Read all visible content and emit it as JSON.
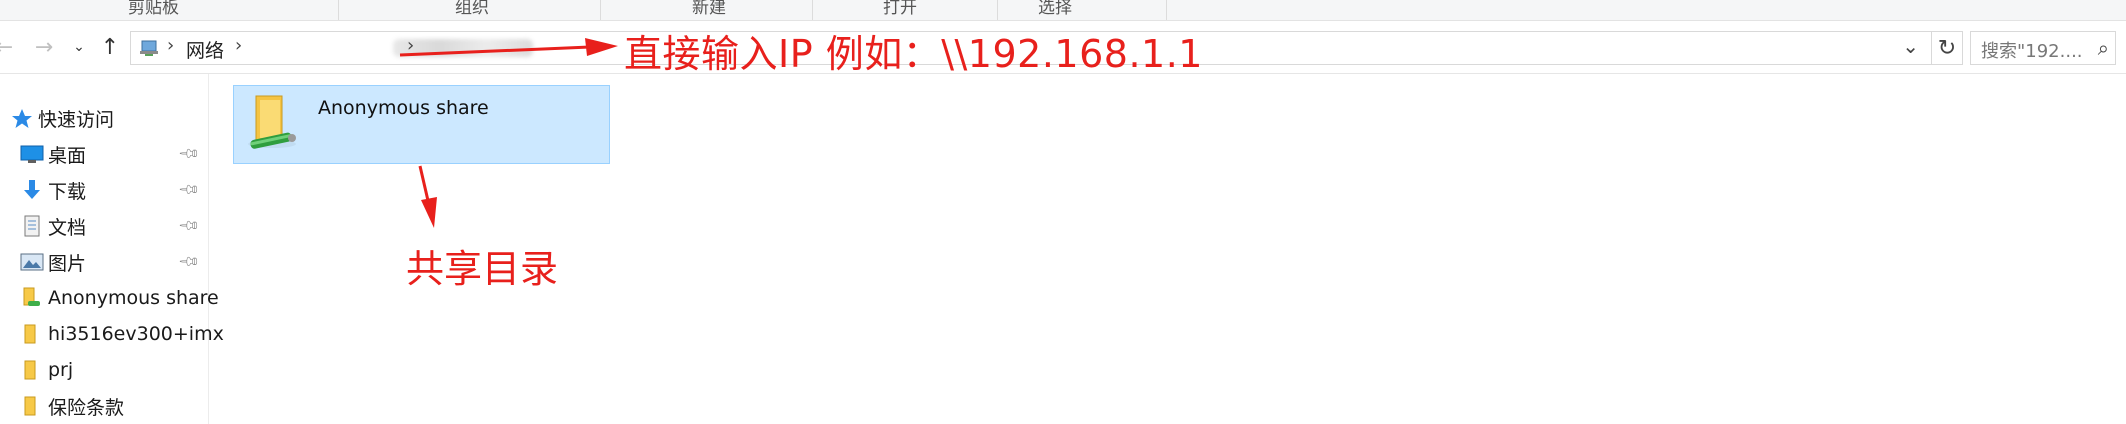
{
  "ribbon": {
    "groups": [
      "剪贴板",
      "组织",
      "新建",
      "打开",
      "选择"
    ]
  },
  "nav": {
    "back_icon": "arrow-left",
    "forward_icon": "arrow-right",
    "recent_icon": "chevron-down",
    "up_icon": "arrow-up",
    "address": {
      "crumb": "网络",
      "blurred_segment": "(redacted)",
      "dropdown_icon": "chevron-down"
    },
    "refresh_icon": "refresh",
    "search_placeholder": "搜索\"192....",
    "search_icon": "magnifier"
  },
  "annotations": {
    "address_hint": "直接输入IP 例如：\\\\192.168.1.1",
    "share_hint": "共享目录",
    "color": "#e8201c"
  },
  "sidebar": {
    "items": [
      {
        "label": "快速访问",
        "icon": "star-icon",
        "pinned": false
      },
      {
        "label": "桌面",
        "icon": "desktop-icon",
        "pinned": true
      },
      {
        "label": "下载",
        "icon": "download-icon",
        "pinned": true
      },
      {
        "label": "文档",
        "icon": "document-icon",
        "pinned": true
      },
      {
        "label": "图片",
        "icon": "pictures-icon",
        "pinned": true
      },
      {
        "label": "Anonymous share",
        "icon": "shared-folder-icon",
        "pinned": false
      },
      {
        "label": "hi3516ev300+imx",
        "icon": "folder-icon",
        "pinned": false
      },
      {
        "label": "prj",
        "icon": "folder-icon",
        "pinned": false
      },
      {
        "label": "保险条款",
        "icon": "folder-icon",
        "pinned": false
      }
    ]
  },
  "content": {
    "items": [
      {
        "label": "Anonymous share",
        "icon": "network-share-folder-icon",
        "selected": true
      }
    ]
  },
  "colors": {
    "selection_bg": "#cce8ff",
    "selection_border": "#99d1ff",
    "annotation": "#e8201c"
  }
}
